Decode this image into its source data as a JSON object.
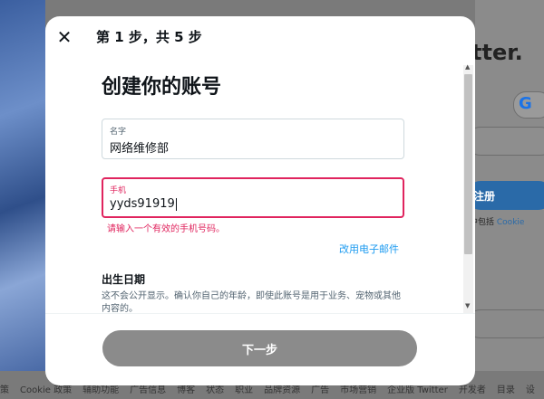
{
  "modal": {
    "step_title": "第 1 步，共 5 步",
    "heading": "创建你的账号",
    "name_field": {
      "label": "名字",
      "value": "网络维修部"
    },
    "phone_field": {
      "label": "手机",
      "value": "yyds91919"
    },
    "error": "请输入一个有效的手机号码。",
    "use_email_link": "改用电子邮件",
    "dob": {
      "title": "出生日期",
      "description": "这不会公开显示。确认你自己的年龄，即使此账号是用于业务、宠物或其他内容的。"
    },
    "next_button": "下一步",
    "close_icon": "close-icon",
    "colors": {
      "error": "#e0245e",
      "link": "#1d9bf0",
      "disabled_button": "#8b8b8b"
    }
  },
  "background": {
    "brand_text": "tter.",
    "google_letter": "G",
    "signup_text": "注册",
    "cookie_note_prefix": "中包括",
    "cookie_note_link": "Cookie",
    "footer": [
      "策",
      "Cookie 政策",
      "辅助功能",
      "广告信息",
      "博客",
      "状态",
      "职业",
      "品牌资源",
      "广告",
      "市场营销",
      "企业版 Twitter",
      "开发者",
      "目录",
      "设"
    ]
  }
}
